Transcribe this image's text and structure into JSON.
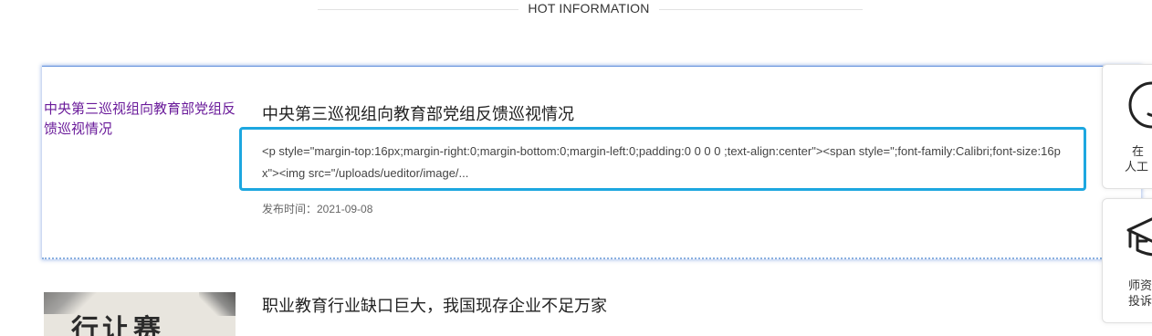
{
  "section": {
    "title": "HOT INFORMATION"
  },
  "news": [
    {
      "thumb_alt_text": "中央第三巡视组向教育部党组反馈巡视情况",
      "title": "中央第三巡视组向教育部党组反馈巡视情况",
      "summary": "<p style=\"margin-top:16px;margin-right:0;margin-bottom:0;margin-left:0;padding:0 0 0 0 ;text-align:center\"><span style=\";font-family:Calibri;font-size:16px\"><img src=\"/uploads/ueditor/image/...",
      "date": "发布时间：2021-09-08"
    },
    {
      "thumb_ink_text": "行让赛",
      "title": "职业教育行业缺口巨大，我国现存企业不足万家"
    }
  ],
  "side_widgets": [
    {
      "icon": "smiley-icon",
      "label_line1": "在",
      "label_line2": "人工"
    },
    {
      "icon": "graduation-cap-icon",
      "label_line1": "师资",
      "label_line2": "投诉"
    }
  ],
  "colors": {
    "visited_link": "#6a1b9a",
    "summary_border": "#1da7e0",
    "card_shadow": "#5b8cdb"
  }
}
